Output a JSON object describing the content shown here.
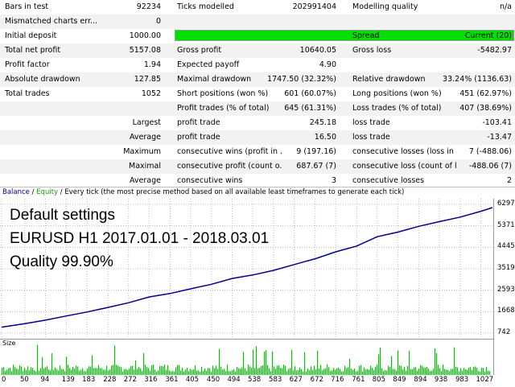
{
  "report": {
    "row1": {
      "label1": "Bars in test",
      "value1": "92234",
      "label2": "Ticks modelled",
      "value2": "202991404",
      "label3": "Modelling quality",
      "value3": "n/a"
    },
    "row2": {
      "label1": "Mismatched charts err...",
      "value1": "0"
    },
    "row3": {
      "label1": "Initial deposit",
      "value1": "1000.00",
      "label3": "Spread",
      "value3": "Current (20)"
    },
    "row4": {
      "label1": "Total net profit",
      "value1": "5157.08",
      "label2": "Gross profit",
      "value2": "10640.05",
      "label3": "Gross loss",
      "value3": "-5482.97"
    },
    "row5": {
      "label1": "Profit factor",
      "value1": "1.94",
      "label2": "Expected payoff",
      "value2": "4.90"
    },
    "row6": {
      "label1": "Absolute drawdown",
      "value1": "127.85",
      "label2": "Maximal drawdown",
      "value2": "1747.50 (32.32%)",
      "label3": "Relative drawdown",
      "value3": "33.24% (1136.63)"
    },
    "row7": {
      "label1": "Total trades",
      "value1": "1052",
      "label2": "Short positions (won %)",
      "value2": "601 (60.07%)",
      "label3": "Long positions (won %)",
      "value3": "451 (62.97%)"
    },
    "row8": {
      "label2": "Profit trades (% of total)",
      "value2": "645 (61.31%)",
      "label3": "Loss trades (% of total)",
      "value3": "407 (38.69%)"
    },
    "row9": {
      "labelr": "Largest",
      "label2": "profit trade",
      "value2": "245.18",
      "label3": "loss trade",
      "value3": "-103.41"
    },
    "row10": {
      "labelr": "Average",
      "label2": "profit trade",
      "value2": "16.50",
      "label3": "loss trade",
      "value3": "-13.47"
    },
    "row11": {
      "labelr": "Maximum",
      "label2": "consecutive wins (profit in ...",
      "value2": "9 (197.16)",
      "label3": "consecutive losses (loss in ...",
      "value3": "7 (-488.06)"
    },
    "row12": {
      "labelr": "Maximal",
      "label2": "consecutive profit (count o...",
      "value2": "687.67 (7)",
      "label3": "consecutive loss (count of l...",
      "value3": "-488.06 (7)"
    },
    "row13": {
      "labelr": "Average",
      "label2": "consecutive wins",
      "value2": "3",
      "label3": "consecutive losses",
      "value3": "2"
    }
  },
  "chart": {
    "legend_balance": "Balance",
    "legend_sep": " / ",
    "legend_equity": "Equity",
    "legend_rest": " / Every tick (the most precise method based on all available least timeframes to generate each tick)",
    "overlay_line1": "Default settings",
    "overlay_line2": "EURUSD H1 2017.01.01 - 2018.03.01",
    "overlay_line3": "Quality 99.90%",
    "size_label": "Size",
    "balance_color": "#00008b",
    "equity_color": "#2e8b22",
    "size_color": "#22a822"
  },
  "chart_data": {
    "type": "line",
    "title": "",
    "x_ticks": [
      0,
      50,
      94,
      139,
      183,
      228,
      272,
      316,
      361,
      405,
      450,
      494,
      538,
      583,
      627,
      672,
      716,
      761,
      805,
      849,
      894,
      938,
      983,
      1027
    ],
    "y_ticks": [
      6297,
      5371,
      4445,
      3519,
      2593,
      1668,
      742
    ],
    "ylim": [
      742,
      6297
    ],
    "xlim": [
      0,
      1052
    ],
    "series": [
      {
        "name": "Balance",
        "x": [
          0,
          50,
          94,
          139,
          183,
          228,
          272,
          316,
          361,
          405,
          450,
          494,
          538,
          583,
          627,
          672,
          716,
          761,
          805,
          849,
          894,
          938,
          983,
          1027,
          1052
        ],
        "values": [
          1000,
          1150,
          1300,
          1480,
          1650,
          1850,
          2050,
          2300,
          2450,
          2650,
          2850,
          3100,
          3250,
          3450,
          3700,
          3950,
          4250,
          4500,
          4900,
          5100,
          5350,
          5550,
          5750,
          6000,
          6157
        ]
      }
    ]
  }
}
